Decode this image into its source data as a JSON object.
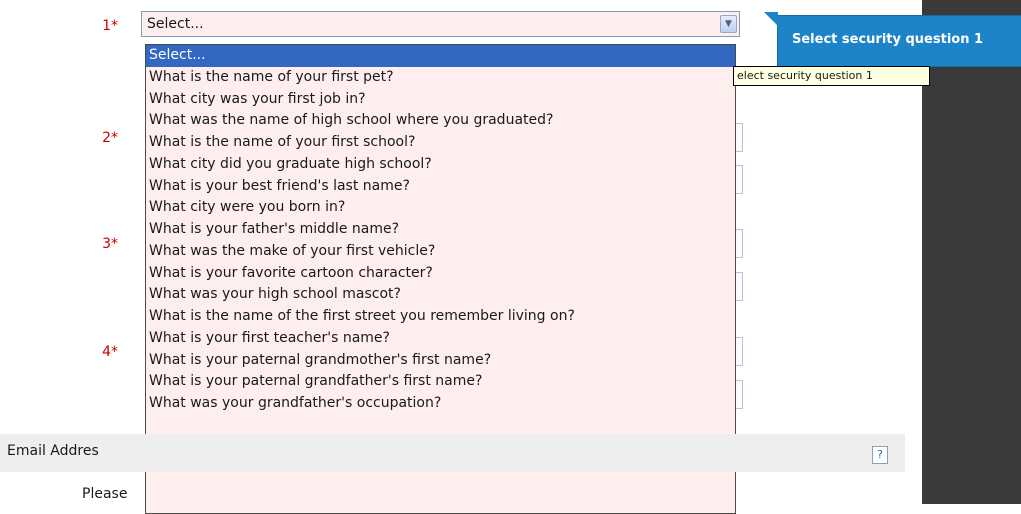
{
  "question_numbers": [
    "1*",
    "2*",
    "3*",
    "4*"
  ],
  "select": {
    "current_value": "Select...",
    "options": [
      "Select...",
      "What is the name of your first pet?",
      "What city was your first job in?",
      "What was the name of high school where you graduated?",
      "What is the name of your first school?",
      "What city did you graduate high school?",
      "What is your best friend's last name?",
      "What city were you born in?",
      "What is your father's middle name?",
      "What was the make of your first vehicle?",
      "What is your favorite cartoon character?",
      "What was your high school mascot?",
      "What is the name of the first street you remember living on?",
      "What is your first teacher's name?",
      "What is your paternal grandmother's first name?",
      "What is your paternal grandfather's first name?",
      "What was your grandfather's occupation?"
    ]
  },
  "callout": {
    "text": "Select security question 1"
  },
  "tooltip": {
    "text": "elect security question 1"
  },
  "email": {
    "label": "Email Addres",
    "help": "?"
  },
  "please": {
    "text": "Please"
  },
  "colors": {
    "selected": "#3368c2",
    "callout": "#1d84c9",
    "required": "#cc0000",
    "list_bg": "#ffeeee"
  },
  "icons": {
    "dropdown": "chevron-down-icon",
    "help": "question-icon"
  }
}
